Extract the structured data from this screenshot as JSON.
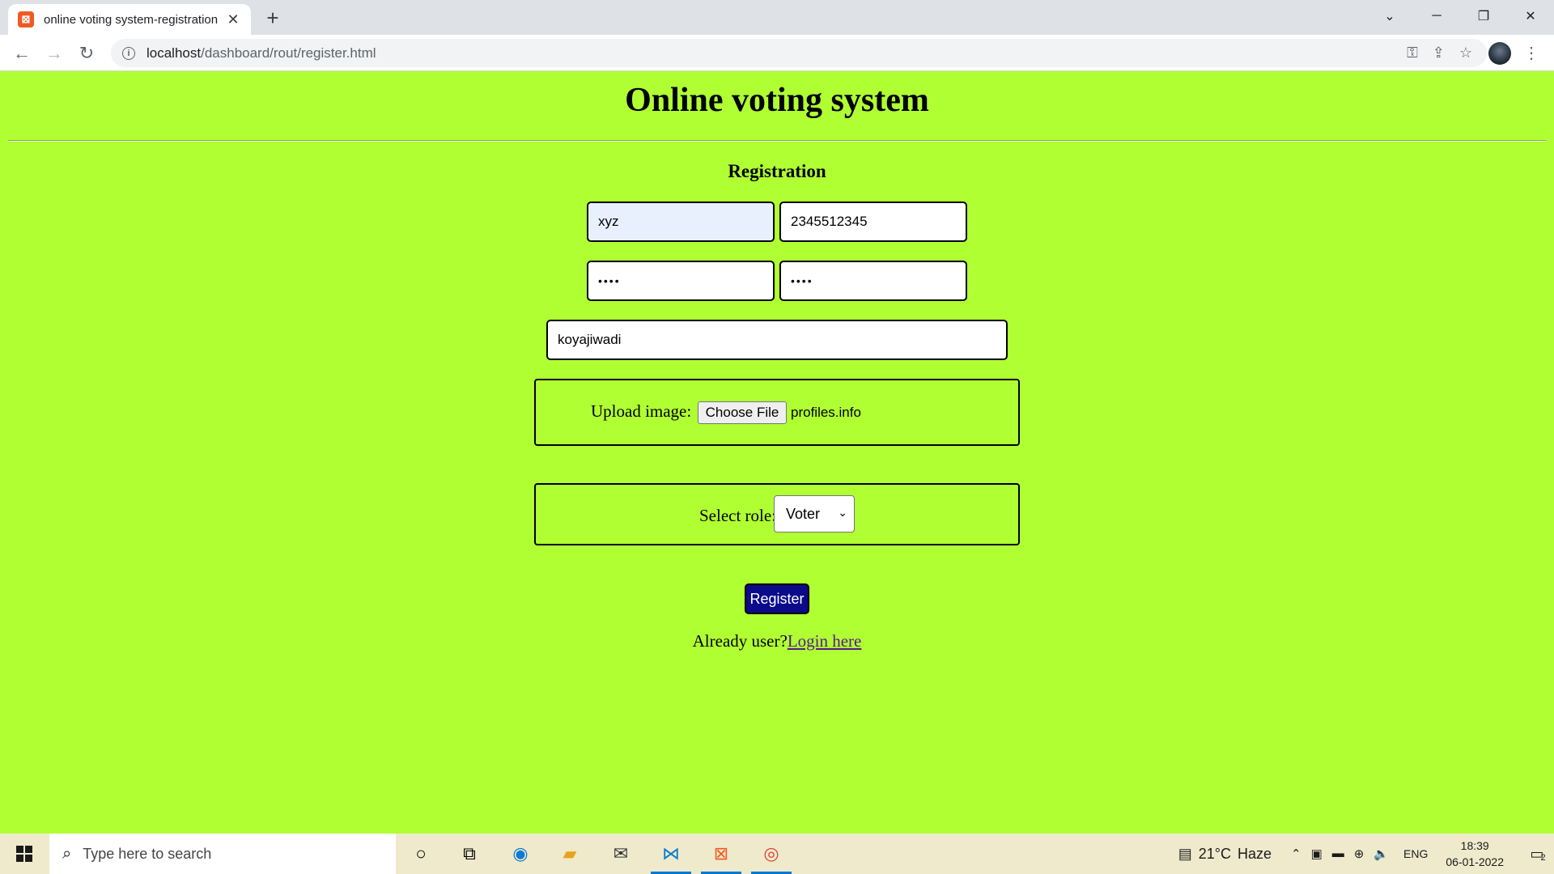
{
  "browser": {
    "tab_title": "online voting system-registration",
    "tab_close": "✕",
    "new_tab": "+",
    "url_host": "localhost",
    "url_path": "/dashboard/rout/register.html",
    "controls": {
      "collapse": "⌄",
      "minimize": "─",
      "restore": "❐",
      "close": "✕"
    }
  },
  "page": {
    "title": "Online voting system",
    "heading": "Registration",
    "fields": {
      "name": "xyz",
      "mobile": "2345512345",
      "password": "••••",
      "confirm_password": "••••",
      "address": "koyajiwadi"
    },
    "upload": {
      "label": "Upload image:",
      "button": "Choose File",
      "file_name": "profiles.info"
    },
    "role": {
      "label": "Select role:",
      "selected": "Voter"
    },
    "register_button": "Register",
    "already_user": "Already user?",
    "login_link": "Login here"
  },
  "taskbar": {
    "search_placeholder": "Type here to search",
    "weather_temp": "21°C",
    "weather_desc": "Haze",
    "language": "ENG",
    "time": "18:39",
    "date": "06-01-2022",
    "notification_count": "2"
  },
  "colors": {
    "page_background": "#b0ff33",
    "register_button": "#0a0a8a",
    "autofill_field": "#e8f0fe"
  }
}
